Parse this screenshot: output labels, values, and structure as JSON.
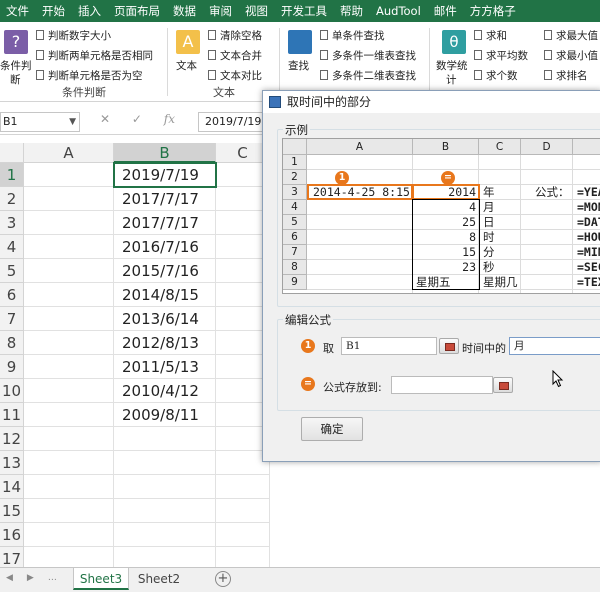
{
  "menu": [
    "文件",
    "开始",
    "插入",
    "页面布局",
    "数据",
    "审阅",
    "视图",
    "开发工具",
    "帮助",
    "AudTool",
    "邮件",
    "方方格子"
  ],
  "ribbon": {
    "group1": {
      "big_label": "条件判",
      "big_label2": "断",
      "items": [
        "判断数字大小",
        "判断两单元格是否相同",
        "判断单元格是否为空"
      ],
      "label": "条件判断"
    },
    "group2": {
      "big_label": "文本",
      "items": [
        "清除空格",
        "文本合并",
        "文本对比"
      ],
      "label": "文本"
    },
    "group3": {
      "big_label": "查找",
      "items": [
        "单条件查找",
        "多条件一维表查找",
        "多条件二维表查找"
      ]
    },
    "group4": {
      "big_label": "数学统",
      "big_label2": "计",
      "items_a": [
        "求和",
        "求平均数",
        "求个数"
      ],
      "items_b": [
        "求最大值",
        "求最小值",
        "求排名"
      ]
    }
  },
  "formula_bar": {
    "name_box": "B1",
    "value": "2019/7/19",
    "cancel": "✕",
    "confirm": "✓",
    "fx": "fx"
  },
  "sheet": {
    "columns": [
      "A",
      "B",
      "C"
    ],
    "rows": [
      "1",
      "2",
      "3",
      "4",
      "5",
      "6",
      "7",
      "8",
      "9",
      "10",
      "11",
      "12",
      "13",
      "14",
      "15",
      "16",
      "17"
    ],
    "values": [
      "2019/7/19",
      "2017/7/17",
      "2017/7/17",
      "2016/7/16",
      "2015/7/16",
      "2014/8/15",
      "2013/6/14",
      "2012/8/13",
      "2011/5/13",
      "2010/4/12",
      "2009/8/11"
    ]
  },
  "tabs": {
    "sheets": [
      "Sheet3",
      "Sheet2"
    ],
    "add": "+"
  },
  "dialog": {
    "title": "取时间中的部分",
    "example_legend": "示例",
    "mini": {
      "cols": [
        "A",
        "B",
        "C",
        "D"
      ],
      "rows": [
        "1",
        "2",
        "3",
        "4",
        "5",
        "6",
        "7",
        "8",
        "9"
      ],
      "a3": "2014-4-25 8:15",
      "b_values": [
        "2014",
        "4",
        "25",
        "8",
        "15",
        "23",
        "星期五"
      ],
      "c_labels": [
        "年",
        "月",
        "日",
        "时",
        "分",
        "秒",
        "星期几"
      ],
      "formula_label": "公式：",
      "formulas": [
        "=YEA",
        "=MON",
        "=DAT",
        "=HOU",
        "=MIN",
        "=SEC",
        "=TEX"
      ],
      "badge_one": "1",
      "badge_eq": "="
    },
    "edit_legend": "编辑公式",
    "take_label": "取",
    "source_value": "B1",
    "in_time_label": "时间中的",
    "part_value": "月",
    "store_label": "公式存放到:",
    "store_value": "",
    "ok_label": "确定"
  },
  "colors": {
    "excel_green": "#217346",
    "badge_orange": "#e8771c"
  }
}
